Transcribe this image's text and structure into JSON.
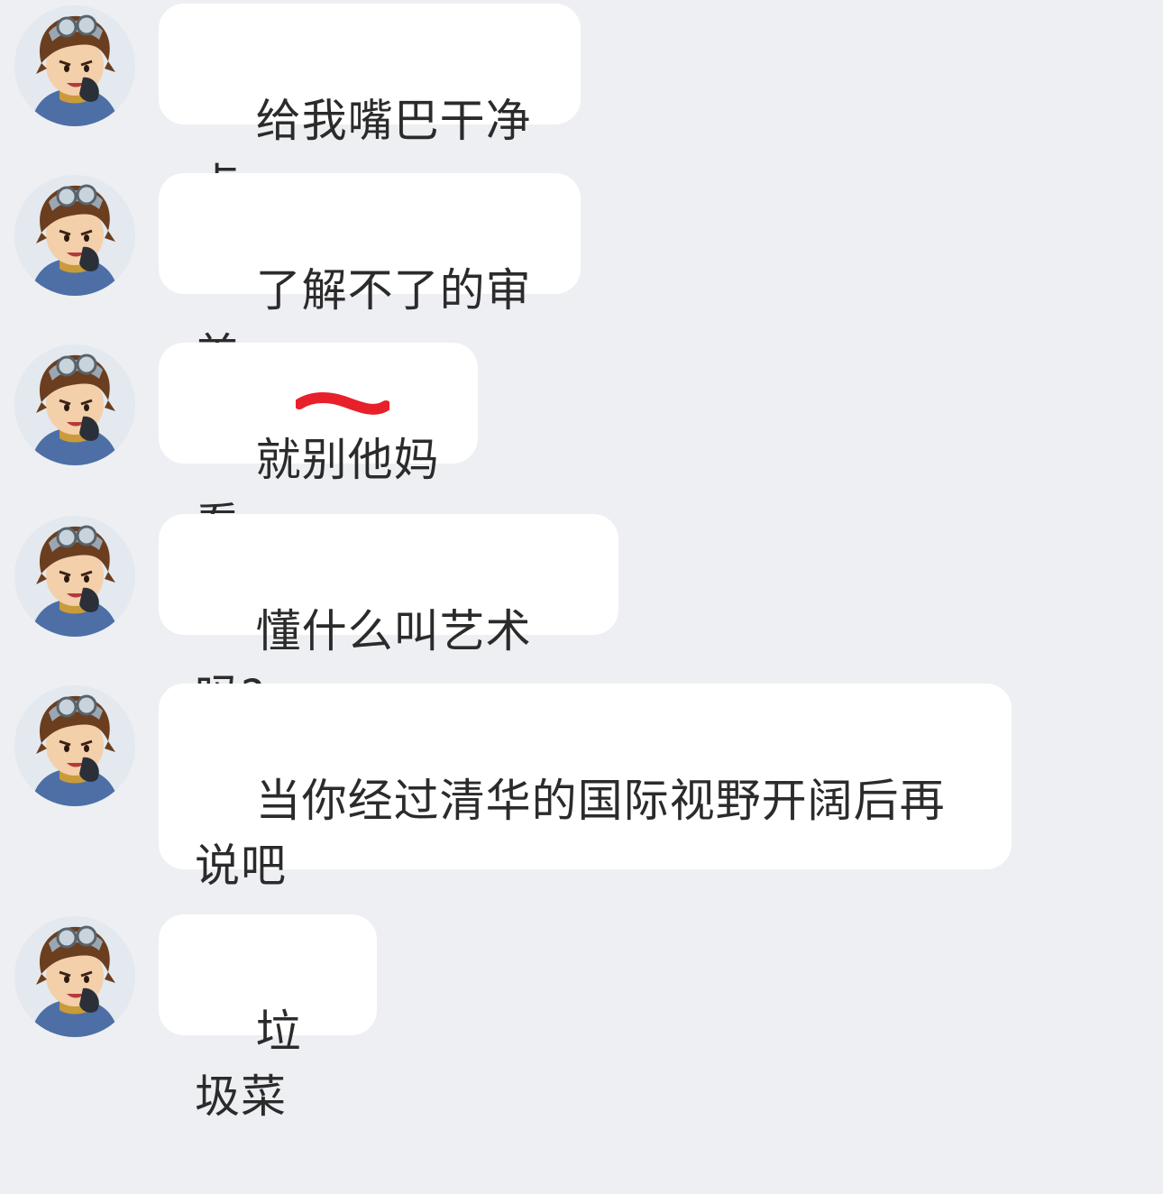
{
  "theme": {
    "background": "#eeeff3",
    "bubble_color": "#ffffff",
    "text_color": "#2b2b2b",
    "redaction_color": "#e8202a"
  },
  "messages": [
    {
      "text": "给我嘴巴干净点",
      "avatar": "cartoon-boy-avatar"
    },
    {
      "text": "了解不了的审美",
      "avatar": "cartoon-boy-avatar"
    },
    {
      "text": "就别他妈看",
      "avatar": "cartoon-boy-avatar",
      "redacted_words": "他妈"
    },
    {
      "text": "懂什么叫艺术吗?",
      "avatar": "cartoon-boy-avatar"
    },
    {
      "text": "当你经过清华的国际视野开阔后再\n说吧",
      "avatar": "cartoon-boy-avatar"
    },
    {
      "text": "垃圾菜",
      "avatar": "cartoon-boy-avatar"
    }
  ]
}
